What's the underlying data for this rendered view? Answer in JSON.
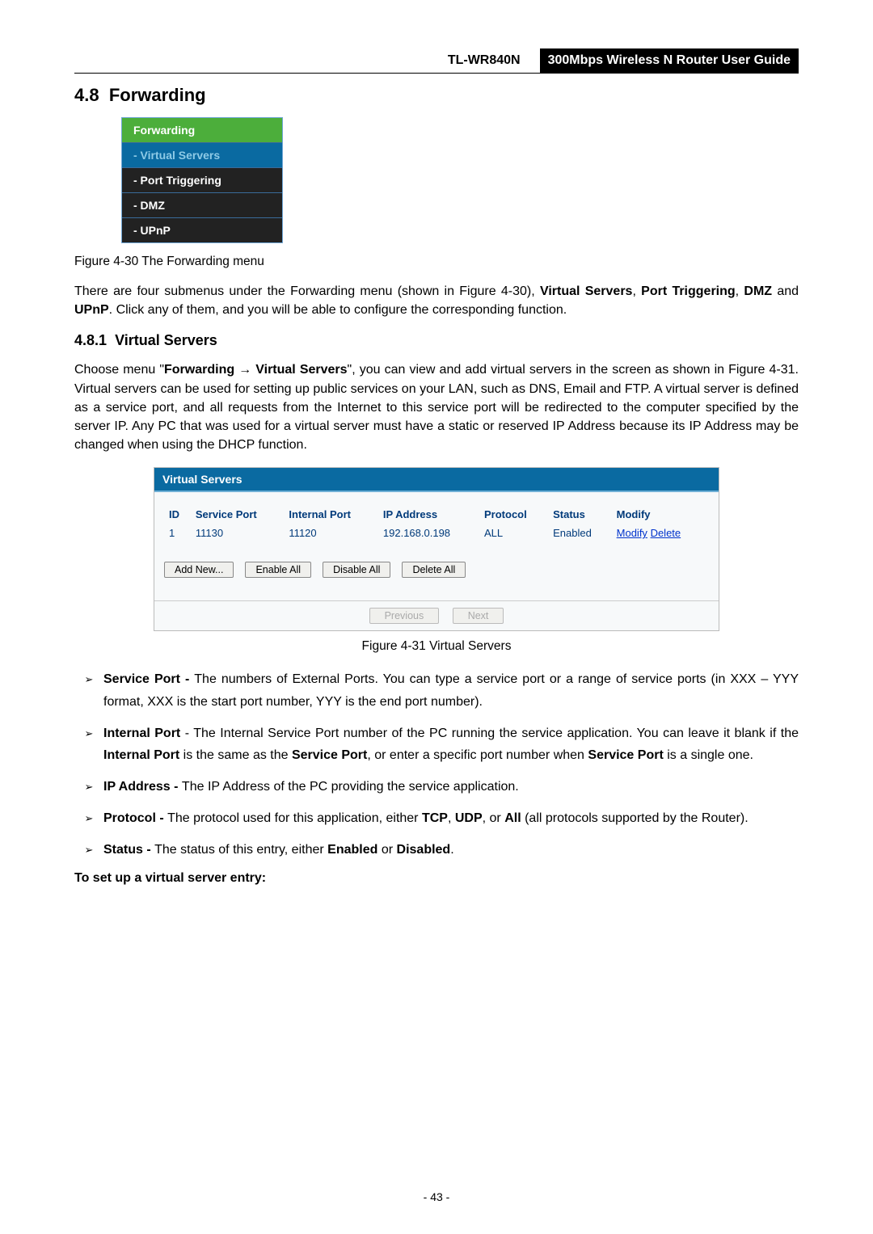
{
  "header": {
    "model": "TL-WR840N",
    "guide_title": "300Mbps Wireless N Router User Guide"
  },
  "section": {
    "number": "4.8",
    "title": "Forwarding"
  },
  "nav_menu": {
    "head": "Forwarding",
    "items": [
      "- Virtual Servers",
      "- Port Triggering",
      "- DMZ",
      "- UPnP"
    ]
  },
  "fig30_caption": "Figure 4-30 The Forwarding menu",
  "para1_parts": {
    "p1": "There are four submenus under the Forwarding menu (shown in Figure 4-30), ",
    "b1": "Virtual Servers",
    "p2": ", ",
    "b2": "Port Triggering",
    "p3": ", ",
    "b3": "DMZ",
    "p4": " and ",
    "b4": "UPnP",
    "p5": ". Click any of them, and you will be able to configure the corresponding function."
  },
  "subsection": {
    "number": "4.8.1",
    "title": "Virtual Servers"
  },
  "para2_parts": {
    "p1": "Choose menu \"",
    "b1": "Forwarding",
    "arrow": " → ",
    "b2": "Virtual Servers",
    "p2": "\", you can view and add virtual servers in the screen as shown in Figure 4-31. Virtual servers can be used for setting up public services on your LAN, such as DNS, Email and FTP. A virtual server is defined as a service port, and all requests from the Internet to this service port will be redirected to the computer specified by the server IP. Any PC that was used for a virtual server must have a static or reserved IP Address because its IP Address may be changed when using the DHCP function."
  },
  "vs_panel": {
    "title": "Virtual Servers",
    "headers": [
      "ID",
      "Service Port",
      "Internal Port",
      "IP Address",
      "Protocol",
      "Status",
      "Modify"
    ],
    "row": {
      "id": "1",
      "service_port": "11130",
      "internal_port": "11120",
      "ip": "192.168.0.198",
      "protocol": "ALL",
      "status": "Enabled",
      "modify": "Modify",
      "delete": "Delete"
    },
    "buttons": {
      "add": "Add New...",
      "enable": "Enable All",
      "disable": "Disable All",
      "delete": "Delete All",
      "prev": "Previous",
      "next": "Next"
    }
  },
  "fig31_caption": "Figure 4-31   Virtual Servers",
  "bullets": {
    "b1": {
      "label": "Service Port - ",
      "text": "The numbers of External Ports. You can type a service port or a range of service ports (in XXX – YYY format, XXX is the start port number, YYY is the end port number)."
    },
    "b2": {
      "label": "Internal Port",
      "text1": " - The Internal Service Port number of the PC running the service application. You can leave it blank if the ",
      "b2a": "Internal Port",
      "text2": " is the same as the ",
      "b2b": "Service Port",
      "text3": ", or enter a specific port number when ",
      "b2c": "Service Port",
      "text4": " is a single one."
    },
    "b3": {
      "label": "IP Address - ",
      "text": "The IP Address of the PC providing the service application."
    },
    "b4": {
      "label": "Protocol - ",
      "text1": "The protocol used for this application, either ",
      "b4a": "TCP",
      "text2": ", ",
      "b4b": "UDP",
      "text3": ", or ",
      "b4c": "All",
      "text4": " (all protocols supported by the Router)."
    },
    "b5": {
      "label": "Status - ",
      "text1": "The status of this entry, either ",
      "b5a": "Enabled",
      "text2": " or ",
      "b5b": "Disabled",
      "text3": "."
    }
  },
  "setup_line": "To set up a virtual server entry:",
  "page_num": "- 43 -"
}
